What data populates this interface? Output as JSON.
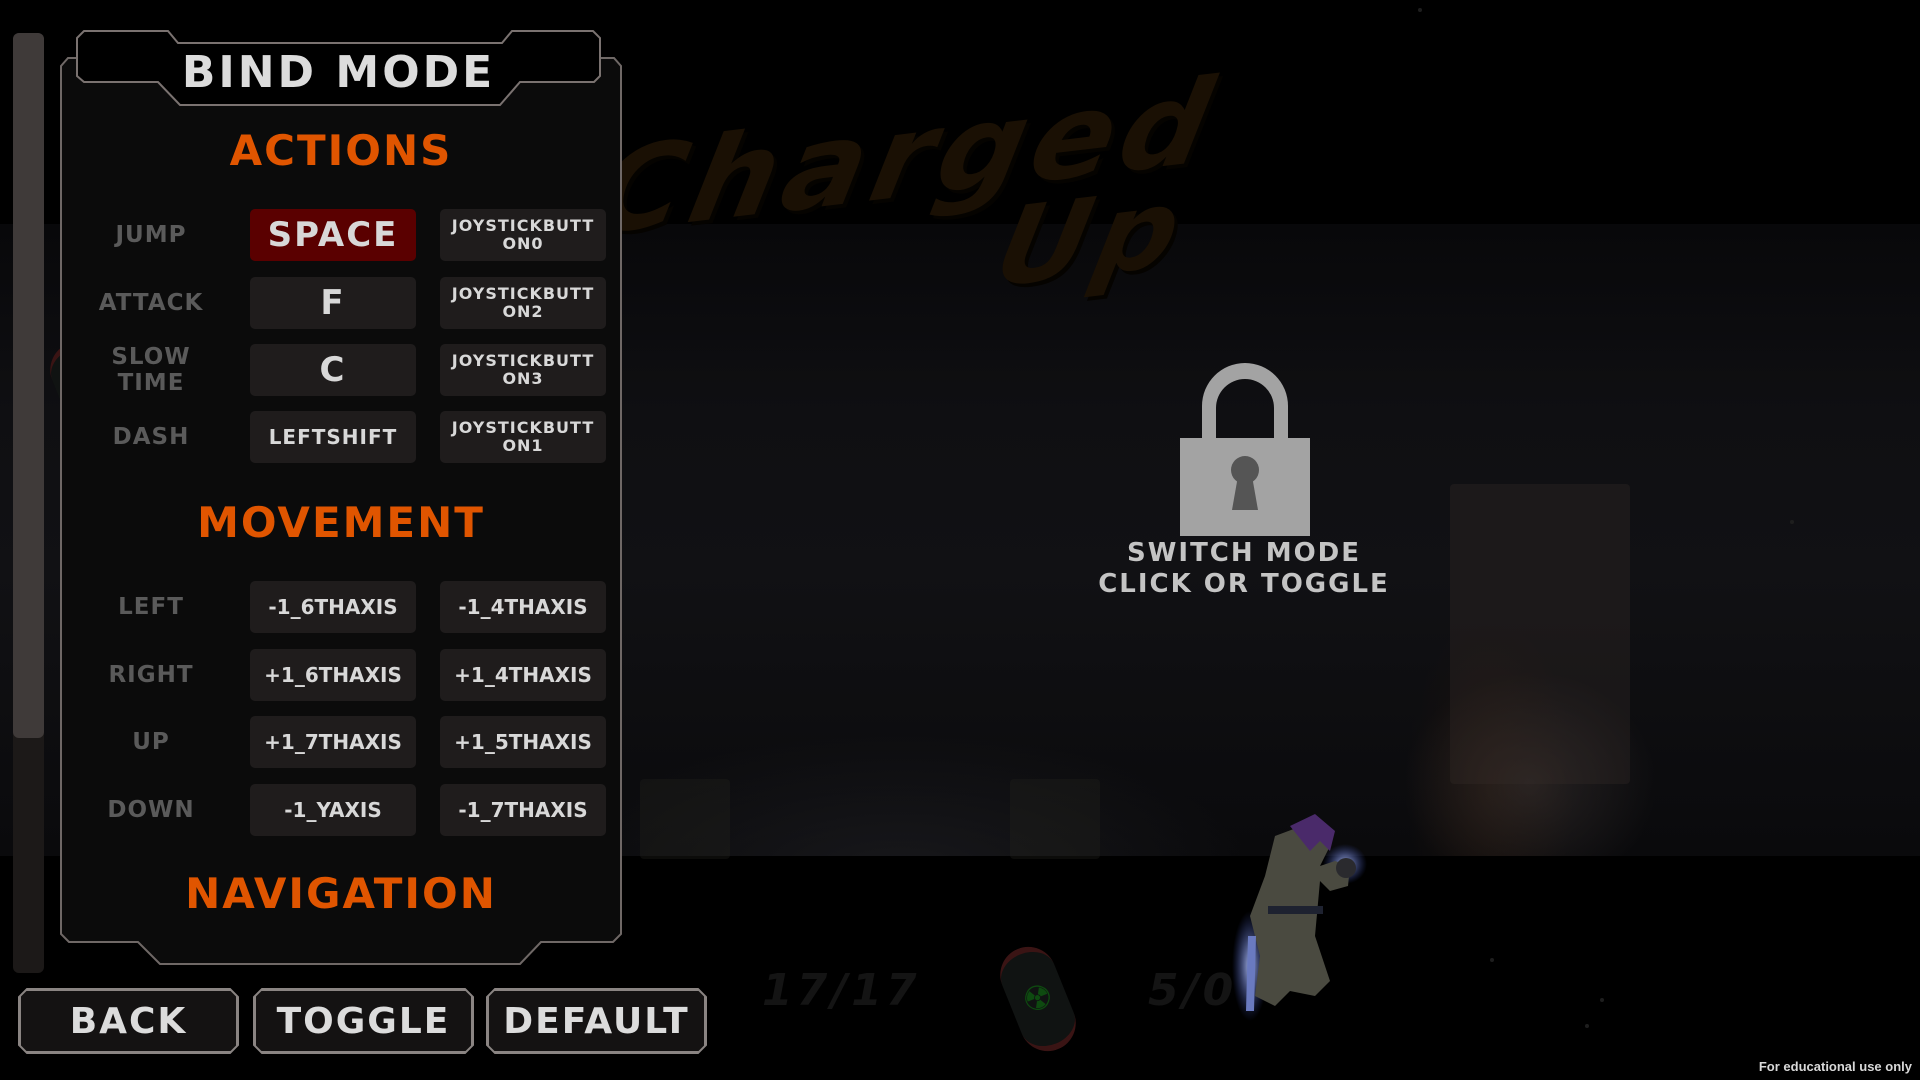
{
  "background": {
    "logo": {
      "line1": "Charged",
      "line2": "Up"
    },
    "hud": {
      "ammo_counter": "17/17",
      "secondary_counter": "5/0"
    }
  },
  "scrollbar": {
    "thumb_fraction": 0.75
  },
  "panel": {
    "title": "Bind Mode",
    "sections": [
      {
        "heading": "Actions",
        "rows": [
          {
            "label": "Jump",
            "primary": "Space",
            "secondary": "JoystickButton0",
            "selected": "primary"
          },
          {
            "label": "Attack",
            "primary": "F",
            "secondary": "JoystickButton2",
            "selected": null
          },
          {
            "label": "Slow Time",
            "primary": "C",
            "secondary": "JoystickButton3",
            "selected": null
          },
          {
            "label": "Dash",
            "primary": "LeftShift",
            "secondary": "JoystickButton1",
            "selected": null
          }
        ]
      },
      {
        "heading": "Movement",
        "rows": [
          {
            "label": "Left",
            "primary": "-1_6thAxis",
            "secondary": "-1_4thAxis"
          },
          {
            "label": "Right",
            "primary": "+1_6thAxis",
            "secondary": "+1_4thAxis"
          },
          {
            "label": "Up",
            "primary": "+1_7thAxis",
            "secondary": "+1_5thAxis"
          },
          {
            "label": "Down",
            "primary": "-1_YAxis",
            "secondary": "-1_7thAxis"
          }
        ]
      },
      {
        "heading": "Navigation",
        "rows": []
      }
    ]
  },
  "footer": {
    "back_label": "Back",
    "toggle_label": "Toggle",
    "default_label": "Default"
  },
  "lock_prompt": {
    "icon": "padlock-icon",
    "line1": "Switch Mode",
    "line2": "Click or Toggle"
  },
  "watermark": "For educational use only",
  "colors": {
    "accent_orange": "#e05500",
    "selected_binding": "#5a0000",
    "binding_bg": "#1f1c1c",
    "text_light": "#d8d8d8",
    "label_grey": "#5a5a5a"
  }
}
